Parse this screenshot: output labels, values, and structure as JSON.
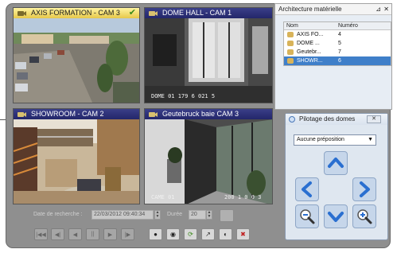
{
  "cameras": [
    {
      "title": "AXIS FORMATION - CAM 3",
      "selected": true,
      "overlay": ""
    },
    {
      "title": "DOME HALL - CAM 1",
      "selected": false,
      "overlay": "DOME 01         179 6 021 5"
    },
    {
      "title": "SHOWROOM - CAM 2",
      "selected": false,
      "overlay": ""
    },
    {
      "title": "Geutebruck baie CAM 3",
      "selected": false,
      "overlay_left": "CAME 01",
      "overlay_right": "200 1 0 0 3"
    }
  ],
  "architecture": {
    "title": "Architecture matérielle",
    "col_name": "Nom",
    "col_number": "Numéro",
    "rows": [
      {
        "name": "AXIS FO...",
        "number": "4",
        "selected": false
      },
      {
        "name": "DOME ...",
        "number": "5",
        "selected": false
      },
      {
        "name": "Geutebr...",
        "number": "7",
        "selected": false
      },
      {
        "name": "SHOWR...",
        "number": "6",
        "selected": true
      }
    ]
  },
  "dome_control": {
    "title": "Pilotage des domes",
    "preset_value": "Aucune préposition"
  },
  "search": {
    "label": "Date de recherche :",
    "date_value": "22/03/2012 09:40:34",
    "duration_label": "Durée",
    "duration_value": "20"
  },
  "icons": {
    "camera": "camera-icon",
    "check": "checkmark-icon",
    "up": "arrow-up-icon",
    "down": "arrow-down-icon",
    "left": "arrow-left-icon",
    "right": "arrow-right-icon",
    "zoom_out": "zoom-out-icon",
    "zoom_in": "zoom-in-icon"
  }
}
